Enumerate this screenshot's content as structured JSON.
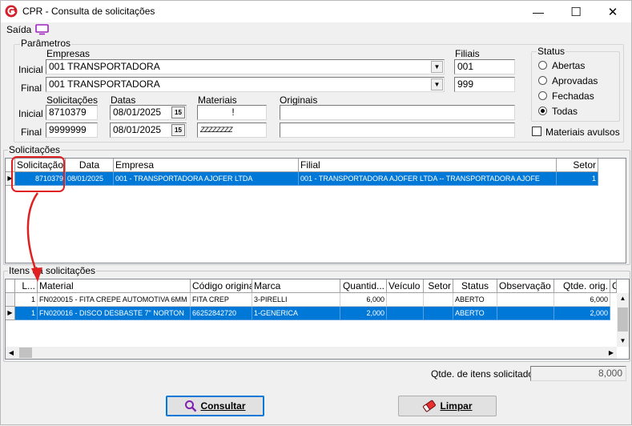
{
  "window": {
    "title": "CPR - Consulta de solicitações",
    "minimize_glyph": "—",
    "maximize_glyph": "☐",
    "close_glyph": "✕"
  },
  "menu": {
    "saida_label": "Saída"
  },
  "parametros": {
    "group_label": "Parâmetros",
    "empresas_label": "Empresas",
    "filiais_label": "Filiais",
    "inicial_label": "Inicial",
    "final_label": "Final",
    "empresa_inicial": "001 TRANSPORTADORA",
    "empresa_final": "001 TRANSPORTADORA",
    "filial_inicial": "001",
    "filial_final": "999",
    "solicitacoes_label": "Solicitações",
    "datas_label": "Datas",
    "materiais_label": "Materiais",
    "originais_label": "Originais",
    "solicitacao_inicial": "8710379",
    "solicitacao_final": "9999999",
    "data_inicial": "08/01/2025",
    "data_final": "08/01/2025",
    "cal_label": "15",
    "material_inicial": "!",
    "material_final": "ZZZZZZZZ",
    "original_inicial": "",
    "original_final": ""
  },
  "status": {
    "group_label": "Status",
    "options": [
      "Abertas",
      "Aprovadas",
      "Fechadas",
      "Todas"
    ],
    "selected": "Todas",
    "materiais_avulsos_label": "Materiais avulsos"
  },
  "solicitacoes": {
    "group_label": "Solicitações",
    "columns": [
      "Solicitação",
      "Data",
      "Empresa",
      "Filial",
      "Setor"
    ],
    "rows": [
      [
        "8710379",
        "08/01/2025",
        "001 - TRANSPORTADORA AJOFER LTDA",
        "001 - TRANSPORTADORA AJOFER LTDA -- TRANSPORTADORA AJOFE",
        "1"
      ]
    ]
  },
  "itens": {
    "group_label": "Itens da solicitações",
    "columns": [
      "L...",
      "Material",
      "Código original",
      "Marca",
      "Quantid...",
      "Veículo",
      "Setor",
      "Status",
      "Observação",
      "Qtde. orig.",
      "C"
    ],
    "rows": [
      [
        "1",
        "FN020015 - FITA CREPE AUTOMOTIVA 6MM",
        "FITA CREP",
        "3-PIRELLI",
        "6,000",
        "",
        "",
        "ABERTO",
        "",
        "6,000",
        ""
      ],
      [
        "1",
        "FN020016 - DISCO DESBASTE 7\" NORTON",
        "66252842720",
        "1-GENERICA",
        "2,000",
        "",
        "",
        "ABERTO",
        "",
        "2,000",
        ""
      ]
    ]
  },
  "footer": {
    "qtde_label": "Qtde. de itens solicitados",
    "qtde_value": "8,000",
    "consultar_label": "Consultar",
    "limpar_label": "Limpar"
  },
  "colors": {
    "selection": "#0078d7",
    "annotation": "#e02020",
    "accent_icon": "#a020c0"
  }
}
